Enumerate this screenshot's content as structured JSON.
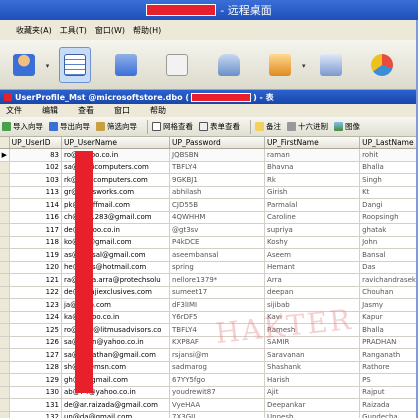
{
  "remote_window": {
    "title": "- 远程桌面",
    "menu": [
      "收藏夹(A)",
      "工具(T)",
      "窗口(W)",
      "帮助(H)"
    ]
  },
  "inner_window": {
    "title_prefix": "UserProfile_Mst @microsoftstore.dbo (",
    "title_suffix": ") - 表",
    "menu": [
      "文件",
      "编辑",
      "查看",
      "窗口",
      "帮助"
    ],
    "toolbar": [
      "导入向导",
      "导出向导",
      "筛选向导",
      "网格查看",
      "表单查看",
      "备注",
      "十六进制",
      "图像"
    ]
  },
  "grid": {
    "columns": [
      "UP_UserID",
      "UP_UserName",
      "UP_Password",
      "UP_FirstName",
      "UP_LastName"
    ],
    "rows": [
      {
        "id": "83",
        "user": "ro@yahoo.co.in",
        "pw": "JQBSBN",
        "fn": "raman",
        "ln": "rohit"
      },
      {
        "id": "102",
        "user": "sa@aditicomputers.com",
        "pw": "TBFLY4",
        "fn": "Bhavna",
        "ln": "Bhalla"
      },
      {
        "id": "103",
        "user": "rk@aditicomputers.com",
        "pw": "9GKBJ1",
        "fn": "Rk",
        "ln": "Singh"
      },
      {
        "id": "113",
        "user": "gr@transworks.com",
        "pw": "abhilash",
        "fn": "Girish",
        "ln": "Kt"
      },
      {
        "id": "114",
        "user": "pk@rediffmail.com",
        "pw": "CJD55B",
        "fn": "Parmalal",
        "ln": "Dangi"
      },
      {
        "id": "116",
        "user": "ch@id31283@gmail.com",
        "pw": "4QWHHM",
        "fn": "Caroline",
        "ln": "Roopsingh"
      },
      {
        "id": "117",
        "user": "de@yahoo.co.in",
        "pw": "@gt3sv",
        "fn": "supriya",
        "ln": "ghatak"
      },
      {
        "id": "118",
        "user": "ko@hn@gmail.com",
        "pw": "P4kDCE",
        "fn": "Koshy",
        "ln": "John"
      },
      {
        "id": "119",
        "user": "as@bansal@gmail.com",
        "pw": "aseembansal",
        "fn": "Aseem",
        "ln": "Bansal"
      },
      {
        "id": "120",
        "user": "he@_das@hotmail.com",
        "pw": "spring",
        "fn": "Hemant",
        "ln": "Das"
      },
      {
        "id": "121",
        "user": "ra@nidra.arra@protechsolu",
        "pw": "nellore1379*",
        "fn": "Arra",
        "ln": "ravichandrasekhar"
      },
      {
        "id": "122",
        "user": "de@balajiexclusives.com",
        "pw": "sumeet17",
        "fn": "deepan",
        "ln": "Chouhan"
      },
      {
        "id": "123",
        "user": "ja@shoo.com",
        "pw": "dF3lIMI",
        "fn": "sijibab",
        "ln": "Jasmy"
      },
      {
        "id": "124",
        "user": "ka@yahoo.co.in",
        "pw": "Y6rDF5",
        "fn": "Kavi",
        "ln": "Kapur"
      },
      {
        "id": "125",
        "user": "ro@user@litmusadvisors.co",
        "pw": "TBFLY4",
        "fn": "Ramesh",
        "ln": "Bhalla"
      },
      {
        "id": "126",
        "user": "sa@dhan@yahoo.co.in",
        "pw": "KXP8AF",
        "fn": "SAMIR",
        "ln": "PRADHAN"
      },
      {
        "id": "127",
        "user": "sa@ganathan@gmail.com",
        "pw": "rsjansi@m",
        "fn": "Saravanan",
        "ln": "Ranganath"
      },
      {
        "id": "128",
        "user": "sh@_n@msn.com",
        "pw": "sadmarog",
        "fn": "Shashank",
        "ln": "Rathore"
      },
      {
        "id": "129",
        "user": "gh@h@gmail.com",
        "pw": "67YY5fgo",
        "fn": "Harish",
        "ln": "PS"
      },
      {
        "id": "130",
        "user": "ab@74@yahoo.co.in",
        "pw": "youdrewit87",
        "fn": "Ajit",
        "ln": "Rajput"
      },
      {
        "id": "131",
        "user": "de@ar.raizada@gmail.com",
        "pw": "VyeHAA",
        "fn": "Deepankar",
        "ln": "Raizada"
      },
      {
        "id": "132",
        "user": "un@da@gmail.com",
        "pw": "7X3GIL",
        "fn": "Unnesh",
        "ln": "Gundecha"
      }
    ]
  },
  "watermark": "HAKTER",
  "colors": {
    "title_blue": "#1f4fb8",
    "redact_red": "#e8202c"
  }
}
